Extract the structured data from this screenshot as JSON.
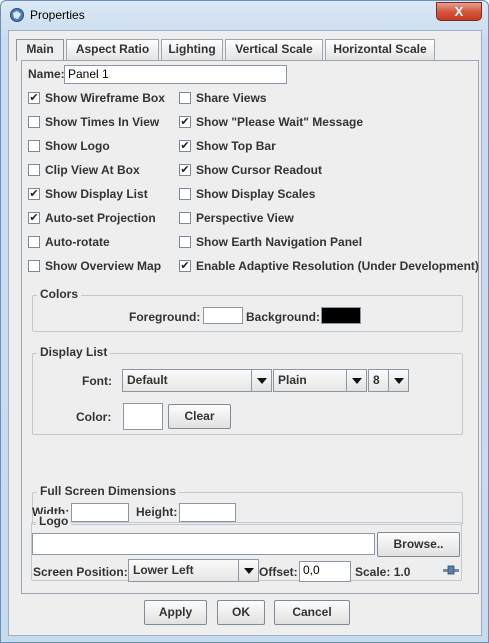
{
  "window": {
    "title": "Properties",
    "close_label": "X"
  },
  "tabs": [
    {
      "label": "Main",
      "active": true
    },
    {
      "label": "Aspect Ratio"
    },
    {
      "label": "Lighting"
    },
    {
      "label": "Vertical Scale"
    },
    {
      "label": "Horizontal Scale"
    }
  ],
  "name_field": {
    "label": "Name:",
    "value": "Panel 1"
  },
  "checkboxes_left": [
    {
      "label": "Show Wireframe Box",
      "checked": true
    },
    {
      "label": "Show Times In View",
      "checked": false
    },
    {
      "label": "Show Logo",
      "checked": false
    },
    {
      "label": "Clip View At Box",
      "checked": false
    },
    {
      "label": "Show Display List",
      "checked": true
    },
    {
      "label": "Auto-set Projection",
      "checked": true
    },
    {
      "label": "Auto-rotate",
      "checked": false
    },
    {
      "label": "Show Overview Map",
      "checked": false
    }
  ],
  "checkboxes_right": [
    {
      "label": "Share Views",
      "checked": false
    },
    {
      "label": "Show \"Please Wait\" Message",
      "checked": true
    },
    {
      "label": "Show Top Bar",
      "checked": true
    },
    {
      "label": "Show Cursor Readout",
      "checked": true
    },
    {
      "label": "Show Display Scales",
      "checked": false
    },
    {
      "label": "Perspective View",
      "checked": false
    },
    {
      "label": "Show Earth Navigation Panel",
      "checked": false
    },
    {
      "label": "Enable Adaptive Resolution (Under Development)",
      "checked": true
    }
  ],
  "colors": {
    "title": "Colors",
    "foreground_label": "Foreground:",
    "background_label": "Background:",
    "foreground_color": "#ffffff",
    "background_color": "#000000"
  },
  "display_list": {
    "title": "Display List",
    "font_label": "Font:",
    "font_value": "Default",
    "style_value": "Plain",
    "size_value": "8",
    "color_label": "Color:",
    "color_value": "#ffffff",
    "clear_label": "Clear"
  },
  "fullscreen": {
    "title": "Full Screen Dimensions",
    "width_label": "Width:",
    "height_label": "Height:",
    "width_value": "",
    "height_value": ""
  },
  "logo": {
    "title": "Logo",
    "path_value": "",
    "browse_label": "Browse..",
    "position_label": "Screen Position:",
    "position_value": "Lower Left",
    "offset_label": "Offset:",
    "offset_value": "0,0",
    "scale_label": "Scale: 1.0"
  },
  "buttons": {
    "apply": "Apply",
    "ok": "OK",
    "cancel": "Cancel"
  },
  "icons": {
    "title": "app-icon",
    "scale": "slider-icon"
  }
}
